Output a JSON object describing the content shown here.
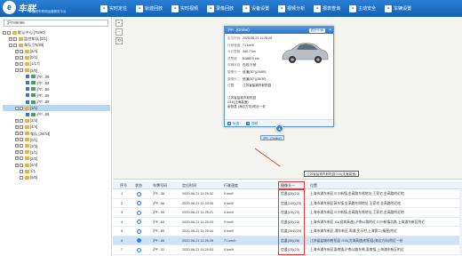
{
  "header": {
    "brand_title": "车联",
    "brand_subtitle": "智慧车联网运营服务平台",
    "nav": [
      {
        "label": "实时定位",
        "icon": "location-icon"
      },
      {
        "label": "轨迹回放",
        "icon": "track-icon"
      },
      {
        "label": "实时视频",
        "icon": "video-icon"
      },
      {
        "label": "录像回放",
        "icon": "playback-icon"
      },
      {
        "label": "设备设置",
        "icon": "device-settings-icon"
      },
      {
        "label": "视频分析",
        "icon": "analysis-icon"
      },
      {
        "label": "报表查询",
        "icon": "report-icon"
      },
      {
        "label": "主动安全",
        "icon": "safety-icon"
      },
      {
        "label": "车辆设置",
        "icon": "car-settings-icon"
      }
    ]
  },
  "sidebar": {
    "search_value": "沪F89086",
    "tree": [
      {
        "indent": 0,
        "toggle": "-",
        "type": "folder",
        "label": "默认中心 [75/90]"
      },
      {
        "indent": 1,
        "toggle": "+",
        "type": "folder",
        "label": "监控车队 [0/1]"
      },
      {
        "indent": 1,
        "toggle": "-",
        "type": "folder",
        "label": "车队 [75/89]"
      },
      {
        "indent": 2,
        "toggle": "+",
        "type": "folder",
        "label": "[2/4]"
      },
      {
        "indent": 2,
        "toggle": "+",
        "type": "folder",
        "label": "[0/1]"
      },
      {
        "indent": 2,
        "toggle": "+",
        "type": "folder",
        "label": "[1/17]"
      },
      {
        "indent": 2,
        "toggle": "-",
        "type": "folder",
        "label": "[3/5]"
      },
      {
        "indent": 3,
        "toggle": "",
        "type": "car",
        "label": "沪F...38",
        "checked": true
      },
      {
        "indent": 3,
        "toggle": "",
        "type": "car",
        "label": "沪F...56",
        "checked": true
      },
      {
        "indent": 3,
        "toggle": "",
        "type": "car",
        "label": "沪F...59",
        "checked": true
      },
      {
        "indent": 3,
        "toggle": "",
        "type": "car",
        "label": "沪F...65",
        "checked": true
      },
      {
        "indent": 3,
        "toggle": "",
        "type": "car",
        "label": "沪F...89",
        "checked": true
      },
      {
        "indent": 2,
        "toggle": "-",
        "type": "folder",
        "label": "[1/1]",
        "selected": true
      },
      {
        "indent": 3,
        "toggle": "",
        "type": "car",
        "label": "沪F...86",
        "checked": true
      },
      {
        "indent": 2,
        "toggle": "+",
        "type": "folder",
        "label": "[2/4]"
      },
      {
        "indent": 2,
        "toggle": "+",
        "type": "folder",
        "label": "[4/4]"
      },
      {
        "indent": 2,
        "toggle": "+",
        "type": "folder",
        "label": "车队 [34/44]"
      },
      {
        "indent": 2,
        "toggle": "+",
        "type": "folder",
        "label": "[0/1]"
      },
      {
        "indent": 2,
        "toggle": "+",
        "type": "folder",
        "label": "[3/3]"
      },
      {
        "indent": 2,
        "toggle": "+",
        "type": "folder",
        "label": "[1/1]"
      },
      {
        "indent": 2,
        "toggle": "+",
        "type": "folder",
        "label": "[2/2]"
      },
      {
        "indent": 2,
        "toggle": "+",
        "type": "folder",
        "label": "[4/4]"
      },
      {
        "indent": 2,
        "toggle": "",
        "type": "folder",
        "label": "1/1"
      },
      {
        "indent": 2,
        "toggle": "",
        "type": "folder",
        "label": "[5/5]"
      }
    ]
  },
  "map": {
    "tools": [
      "+",
      "−",
      "⟲"
    ],
    "popup": {
      "title": "沪F...(Online)",
      "track_label": "跟踪车辆",
      "rows": [
        {
          "label": "定位时间:",
          "value": "2020-06-21 11:26:28"
        },
        {
          "label": "行驶速度:",
          "value": "71 km/h"
        },
        {
          "label": "今日里程:",
          "value": "340.7 km"
        },
        {
          "label": "总里程:",
          "value": "51880.0 km"
        },
        {
          "label": "车辆状态:",
          "value": "在线,行驶"
        },
        {
          "label": "摄像头一:",
          "value": "信道(30°)(24/60)"
        },
        {
          "label": "摄像头二:",
          "value": "信道(30°)(28/30)"
        },
        {
          "label": "位置:",
          "value": "江苏省盐城市射阳县"
        }
      ],
      "address_lines": [
        "江苏省盐城市射阳县",
        "G15(沈海高速)",
        "射阳县 (海边方向)附近一处"
      ],
      "footer": [
        {
          "label": "轨迹",
          "icon": "track-small-icon"
        },
        {
          "label": "视频",
          "icon": "video-small-icon"
        }
      ]
    },
    "marker_label": "沪F...(Online)",
    "bubble": "江苏省盐城市射阳县G15(沈海高速)"
  },
  "table": {
    "headers": [
      "序号",
      "状态",
      "车牌号码",
      "定位时间",
      "行驶速度",
      "",
      "摄像头一",
      "位置"
    ],
    "rows": [
      {
        "no": "1",
        "plate": "沪F...38",
        "time": "2020-06-21 11:25:32",
        "speed": "0 km/h",
        "cam": "信道(23)(23)",
        "addr": "上海市浦东新区川沙新镇,金高路东侧地址,王家宅,金高路附近地"
      },
      {
        "no": "2",
        "plate": "沪F...56",
        "time": "2020-06-21 11:24:05",
        "speed": "0 km/h",
        "cam": "信道(100)(23)",
        "addr": "上海市浦东新区高东镇,金高路东侧地址,王家宅,金高路附近地"
      },
      {
        "no": "3",
        "plate": "沪F...59",
        "time": "2020-06-21 11:25:21",
        "speed": "0 km/h",
        "cam": "信道(23)(23)",
        "addr": "上海市浦东新区川沙新镇,金高路东侧地址,王家宅,金高路附近地"
      },
      {
        "no": "4",
        "plate": "沪F...65",
        "time": "2020-06-21 11:25:03",
        "speed": "0 km/h",
        "cam": "信道(23)(23)",
        "addr": "上海市浦东新区 S1(迎宾高速),沪南公路附近,川沙新镇北路,上海浦东新区附近"
      },
      {
        "no": "5",
        "plate": "沪F...89",
        "time": "2020-06-21 11:25:44",
        "speed": "0 km/h",
        "cam": "信道(394)(26)",
        "addr": "上海市浦东新区,浦东新区,周浦,民乐村,上海第二(福星)附近"
      },
      {
        "no": "6",
        "plate": "沪F...86",
        "time": "2020-06-21 11:26:28",
        "speed": "71 km/h",
        "cam": "信道(30)(28)",
        "addr": "江苏省盐城市射阳县 G15(沈海高速)射阳县(海边方向)附近一处",
        "selected": true
      },
      {
        "no": "7",
        "plate": "沪F...31",
        "time": "2020-06-21 11:25:53",
        "speed": "0 km/h",
        "cam": "信道(23)(23)",
        "addr": "上海市浦东新区惠南镇,沪南公路东侧,惠南镇,上海浦东新区附近"
      }
    ]
  },
  "colors": {
    "header_blue": "#1562b4",
    "accent": "#2d7ce0",
    "highlight_red": "#e23a3a",
    "selected_row": "#cfe2f7"
  }
}
